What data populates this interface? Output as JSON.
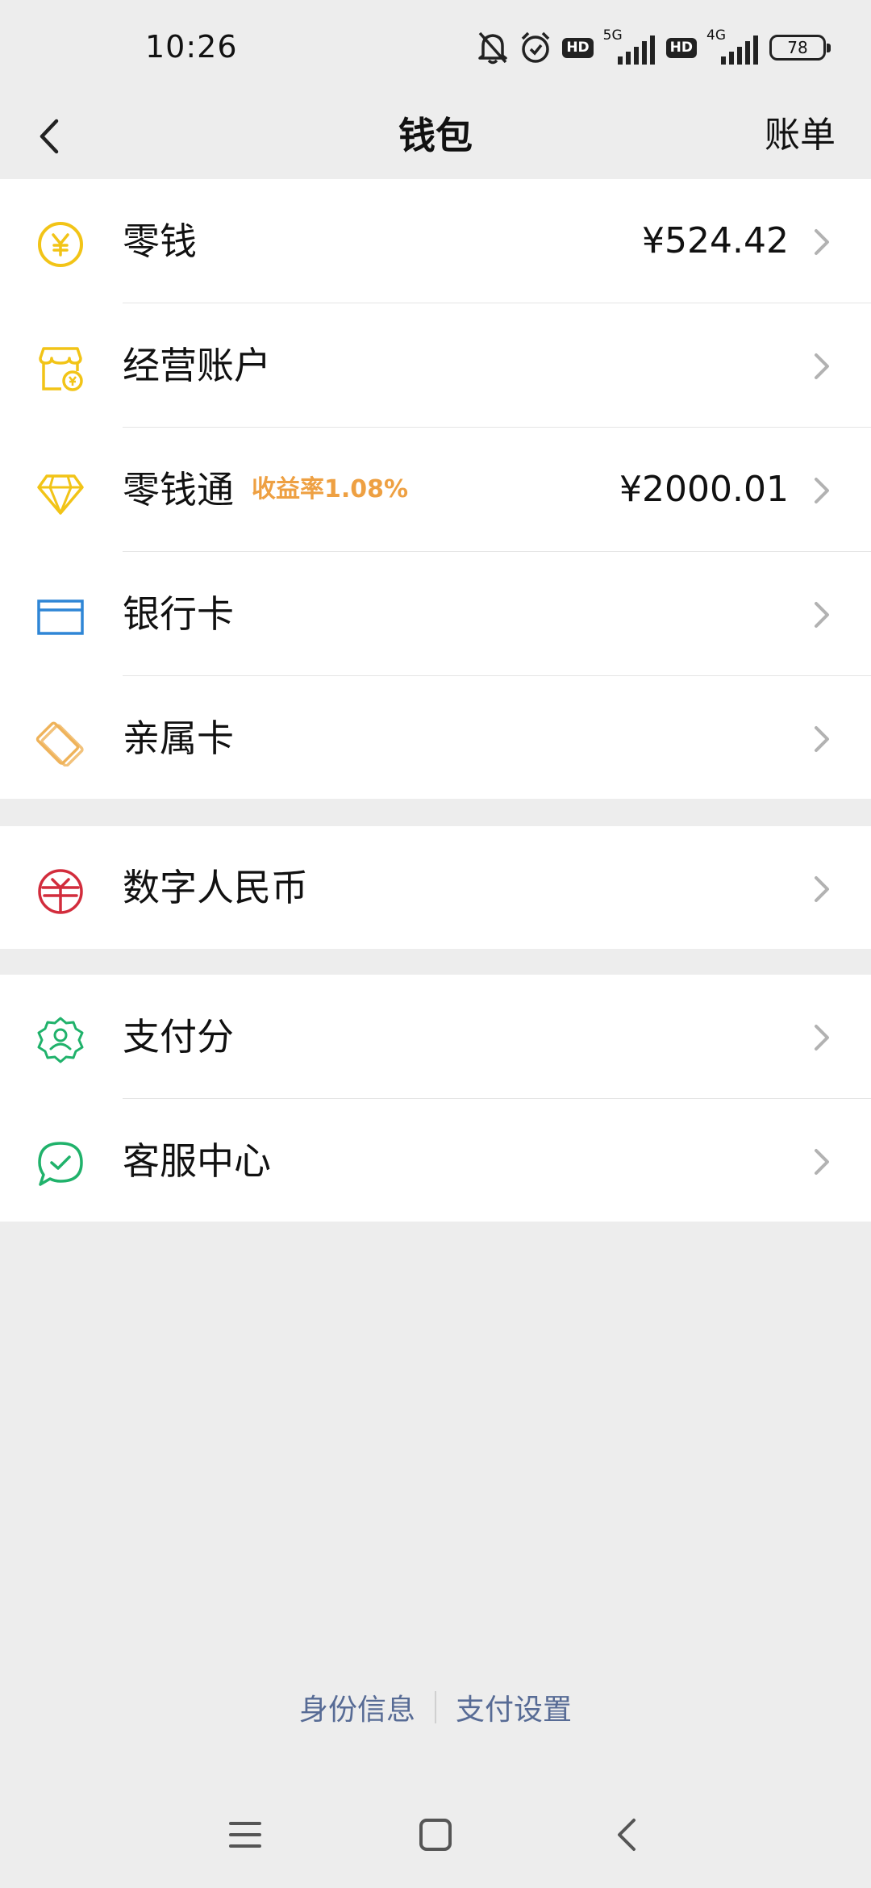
{
  "status_bar": {
    "time": "10:26",
    "net1": "5G",
    "net2": "4G",
    "hd1": "HD",
    "hd2": "HD",
    "battery": "78"
  },
  "nav": {
    "title": "钱包",
    "right": "账单"
  },
  "group1": [
    {
      "label": "零钱",
      "value": "¥524.42",
      "icon": "yuan-coin-icon"
    },
    {
      "label": "经营账户",
      "value": "",
      "icon": "shop-icon"
    },
    {
      "label": "零钱通",
      "tag": "收益率1.08%",
      "value": "¥2000.01",
      "icon": "diamond-icon"
    },
    {
      "label": "银行卡",
      "value": "",
      "icon": "bank-card-icon"
    },
    {
      "label": "亲属卡",
      "value": "",
      "icon": "family-card-icon"
    }
  ],
  "group2": [
    {
      "label": "数字人民币",
      "icon": "digital-rmb-icon"
    }
  ],
  "group3": [
    {
      "label": "支付分",
      "icon": "payment-score-icon"
    },
    {
      "label": "客服中心",
      "icon": "customer-service-icon"
    }
  ],
  "footer": {
    "identity": "身份信息",
    "pay_settings": "支付设置"
  },
  "colors": {
    "background": "#ededed",
    "link": "#576b95",
    "tag": "#eea042",
    "yellow": "#f2c417",
    "blue": "#2f86d6",
    "red": "#d22c3c",
    "green": "#20b26b"
  }
}
